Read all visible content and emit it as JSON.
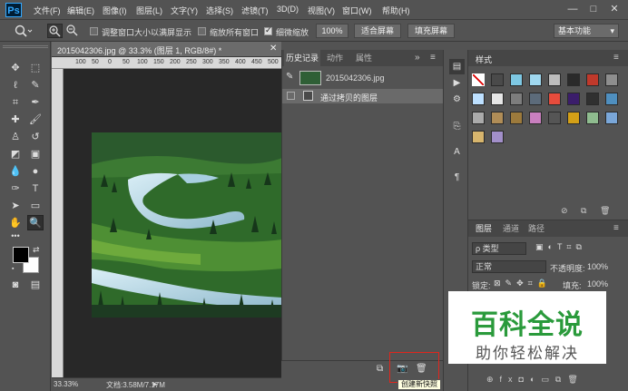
{
  "app": {
    "logo": "Ps"
  },
  "menu": [
    "文件(F)",
    "编辑(E)",
    "图像(I)",
    "图层(L)",
    "文字(Y)",
    "选择(S)",
    "滤镜(T)",
    "3D(D)",
    "视图(V)",
    "窗口(W)",
    "帮助(H)"
  ],
  "window_controls": {
    "minimize": "—",
    "maximize": "□",
    "close": "✕"
  },
  "options": {
    "resize_windows": "调整窗口大小以满屏显示",
    "zoom_all": "缩放所有窗口",
    "scrubby_zoom": "细微缩放",
    "zoom_value": "100%",
    "fit_screen": "适合屏幕",
    "fill_screen": "填充屏幕",
    "workspace": "基本功能"
  },
  "document": {
    "tab_title": "2015042306.jpg @ 33.3% (图层 1, RGB/8#) *",
    "zoom": "33.33%",
    "doc_size": "文档:3.58M/7.17M",
    "ruler_marks": [
      "100",
      "50",
      "0",
      "50",
      "100",
      "150",
      "200",
      "250",
      "300",
      "350",
      "400",
      "450",
      "500"
    ]
  },
  "history": {
    "tabs": [
      "历史记录",
      "动作",
      "属性"
    ],
    "snapshot": "2015042306.jpg",
    "states": [
      "通过拷贝的图层"
    ],
    "tooltip": "创建新快照"
  },
  "styles": {
    "title": "样式"
  },
  "layers": {
    "tabs": [
      "图层",
      "通道",
      "路径"
    ],
    "filter": "ρ 类型",
    "blend_mode": "正常",
    "opacity_label": "不透明度:",
    "opacity": "100%",
    "lock_label": "锁定:",
    "fill_label": "填充:",
    "fill": "100%"
  },
  "watermark": {
    "line1": "百科全说",
    "line2": "助你轻松解决"
  },
  "colors": {
    "accent": "#31a8ff",
    "highlight": "#e0261d",
    "watermark_green": "#2a9a3b"
  }
}
